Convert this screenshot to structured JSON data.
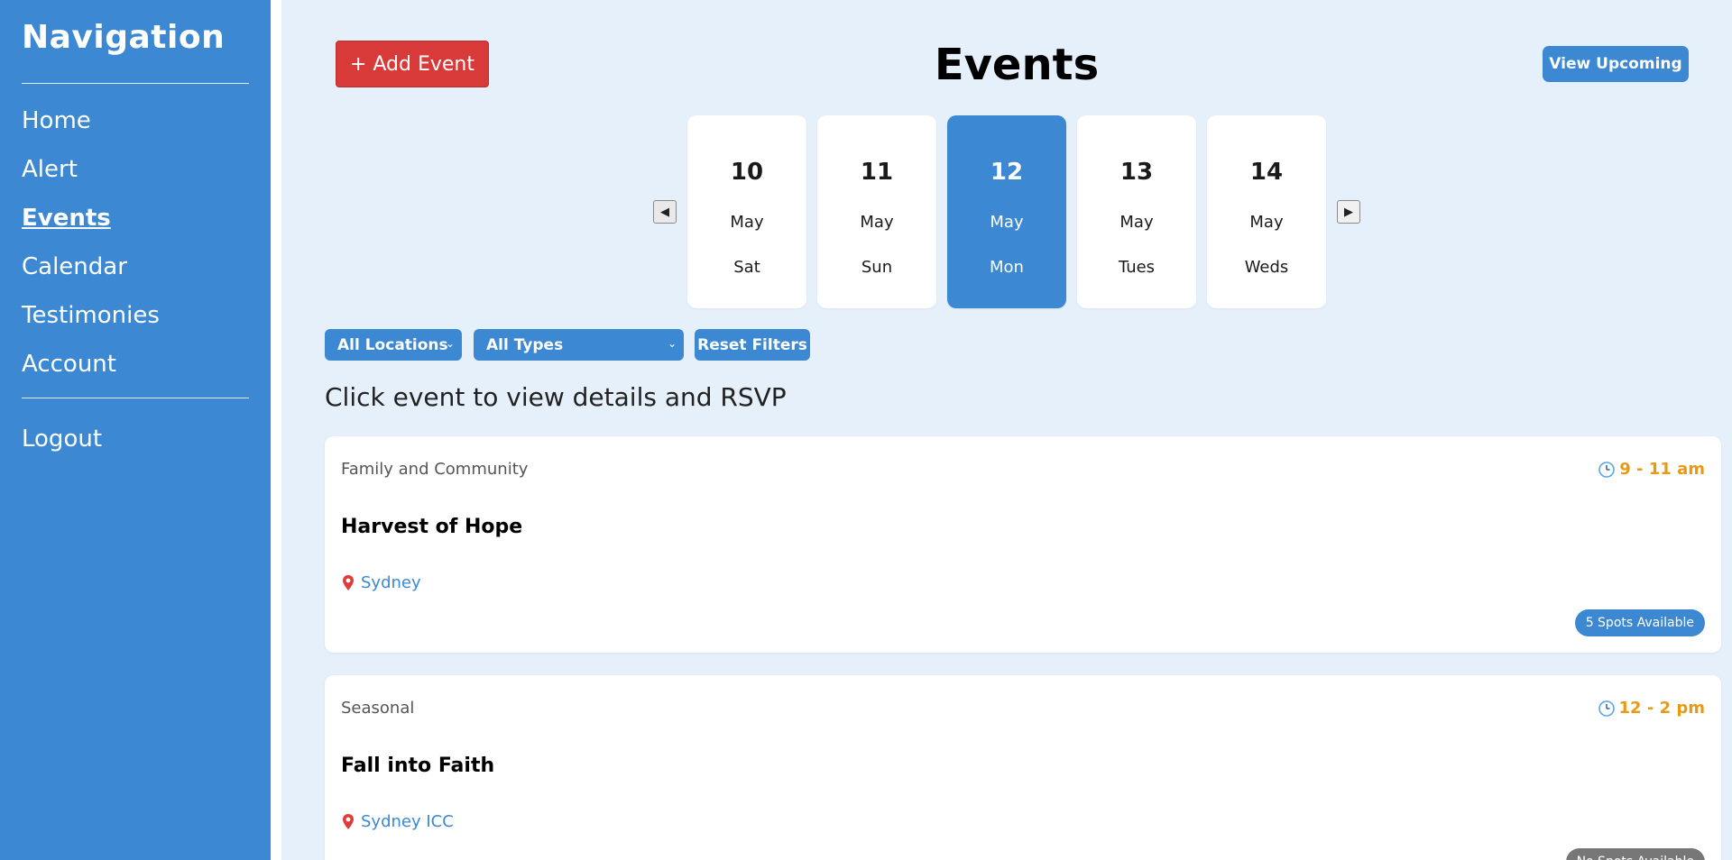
{
  "sidebar": {
    "title": "Navigation",
    "items": [
      {
        "label": "Home",
        "active": false
      },
      {
        "label": "Alert",
        "active": false
      },
      {
        "label": "Events",
        "active": true
      },
      {
        "label": "Calendar",
        "active": false
      },
      {
        "label": "Testimonies",
        "active": false
      },
      {
        "label": "Account",
        "active": false
      }
    ],
    "logout_label": "Logout"
  },
  "header": {
    "add_event_label": "+ Add Event",
    "title": "Events",
    "view_upcoming_label": "View Upcoming"
  },
  "date_picker": {
    "prev_icon": "◀",
    "next_icon": "▶",
    "dates": [
      {
        "day": "10",
        "month": "May",
        "weekday": "Sat",
        "selected": false
      },
      {
        "day": "11",
        "month": "May",
        "weekday": "Sun",
        "selected": false
      },
      {
        "day": "12",
        "month": "May",
        "weekday": "Mon",
        "selected": true
      },
      {
        "day": "13",
        "month": "May",
        "weekday": "Tues",
        "selected": false
      },
      {
        "day": "14",
        "month": "May",
        "weekday": "Weds",
        "selected": false
      }
    ]
  },
  "filters": {
    "location_selected": "All Locations",
    "type_selected": "All Types",
    "reset_label": "Reset Filters"
  },
  "instructions": "Click event to view details and RSVP",
  "events": [
    {
      "category": "Family and Community",
      "time": "9 - 11 am",
      "title": "Harvest of Hope",
      "location": "Sydney",
      "spots": "5 Spots Available"
    },
    {
      "category": "Seasonal",
      "time": "12 - 2 pm",
      "title": "Fall into Faith",
      "location": "Sydney ICC",
      "spots": "No Spots Available"
    }
  ],
  "colors": {
    "sidebar": "#3c88d3",
    "accent": "#3c88d3",
    "danger": "#d83a3a",
    "time": "#e89a12",
    "background": "#e6f0fb"
  },
  "icons": {
    "time": "clock-icon",
    "location": "map-pin-icon",
    "dropdown": "chevron-down-icon"
  }
}
